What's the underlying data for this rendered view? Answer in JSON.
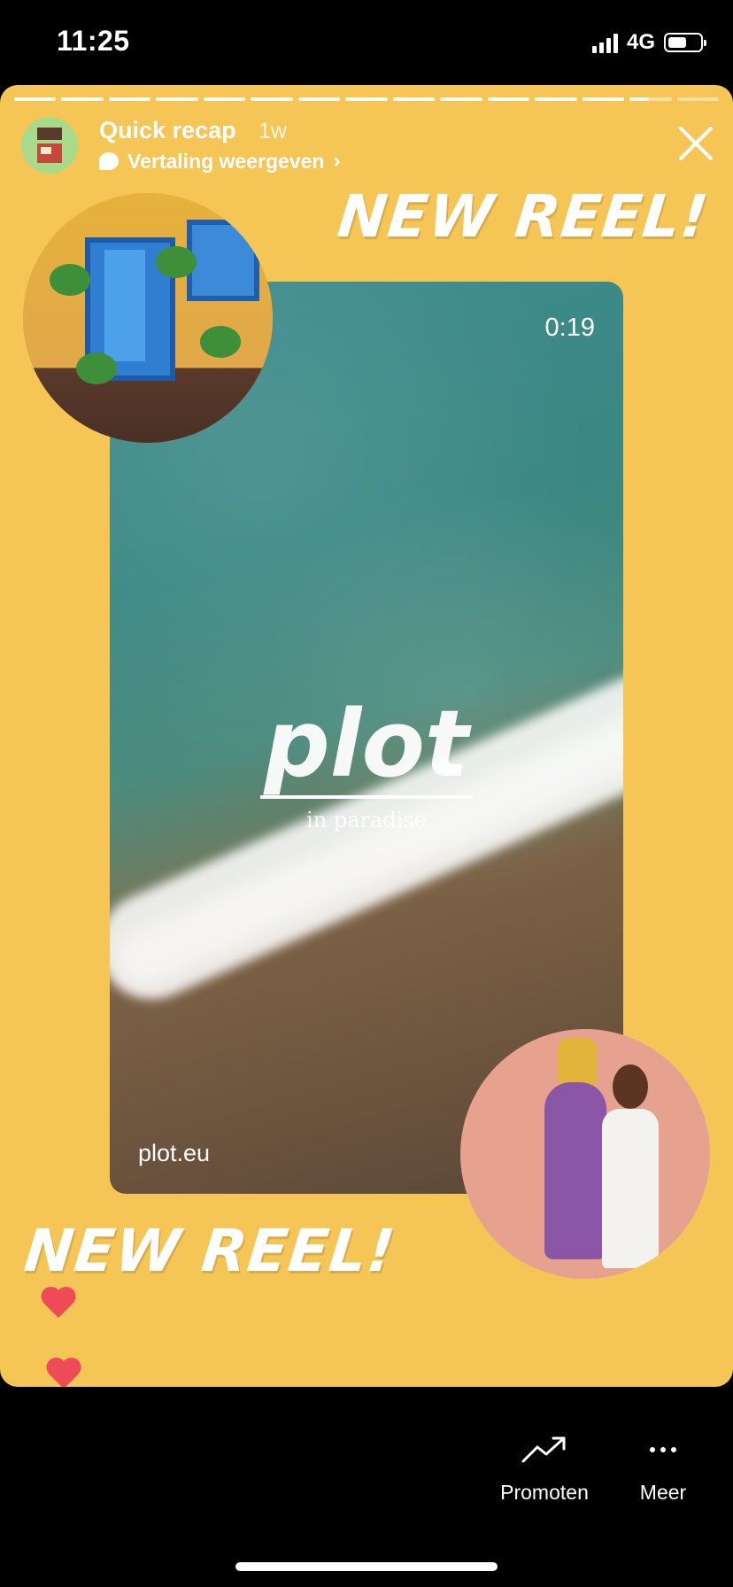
{
  "status_bar": {
    "time": "11:25",
    "network": "4G",
    "battery_fraction": 0.55
  },
  "story": {
    "progress": {
      "segments_total": 15,
      "current_index": 13,
      "current_fraction": 0.45
    },
    "header": {
      "title": "Quick recap",
      "time_ago": "1w",
      "translate_label": "Vertaling weergeven"
    },
    "text_top": "NEW REEL!",
    "text_bottom": "NEW REEL!",
    "reel_preview": {
      "duration": "0:19",
      "logo_word": "plot",
      "logo_tagline": "in paradise",
      "url": "plot.eu"
    },
    "colors": {
      "background": "#f5c656",
      "heart": "#ee4b56"
    }
  },
  "actions": [
    {
      "label": "Promoten",
      "icon": "trending-up-icon"
    },
    {
      "label": "Meer",
      "icon": "more-dots-icon"
    }
  ]
}
